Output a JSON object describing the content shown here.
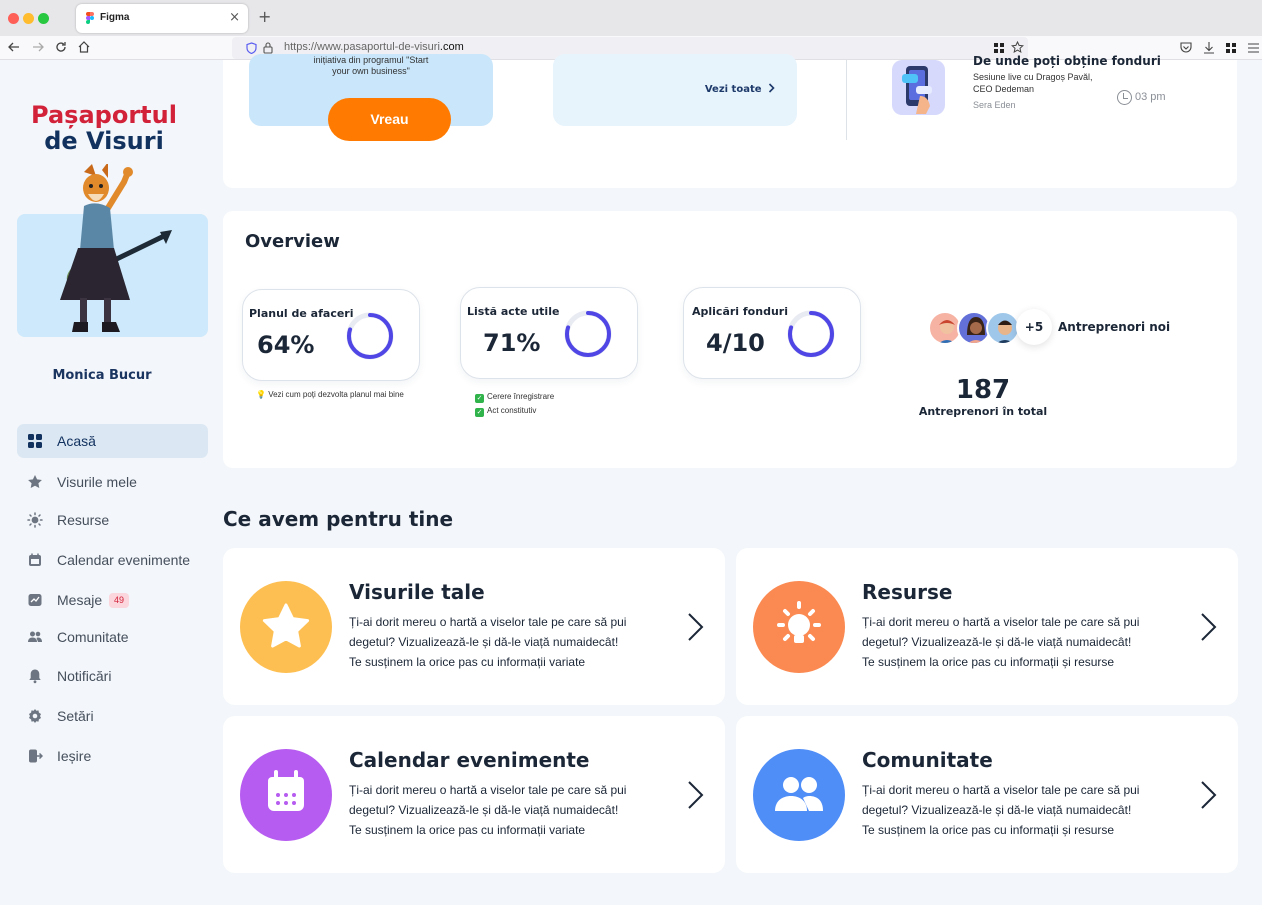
{
  "browser": {
    "tab_title": "Figma",
    "url_prefix": "https://www.pasaportul-de-visuri",
    "url_domain": ".com",
    "tab_close": "×",
    "new_tab": "+"
  },
  "brand": {
    "line1": "Pașaportul",
    "line2": "de Visuri"
  },
  "user": {
    "name": "Monica Bucur"
  },
  "sidebar": {
    "items": [
      {
        "label": "Acasă",
        "icon": "grid-icon"
      },
      {
        "label": "Visurile mele",
        "icon": "star-icon"
      },
      {
        "label": "Resurse",
        "icon": "bulb-icon"
      },
      {
        "label": "Calendar evenimente",
        "icon": "calendar-icon"
      },
      {
        "label": "Mesaje",
        "icon": "chart-message-icon",
        "badge": "49"
      },
      {
        "label": "Comunitate",
        "icon": "people-icon"
      },
      {
        "label": "Notificări",
        "icon": "bell-icon"
      },
      {
        "label": "Setări",
        "icon": "gear-icon"
      },
      {
        "label": "Ieșire",
        "icon": "logout-icon"
      }
    ]
  },
  "top": {
    "promo_text_line1": "inițiativa din programul \"Start",
    "promo_text_line2": "your own business\"",
    "cta": "Vreau",
    "see_all": "Vezi toate",
    "event": {
      "title": "De unde poți obține fonduri",
      "sub1": "Sesiune live cu Dragoș Pavăl,",
      "sub2": "CEO Dedeman",
      "host": "Sera Eden",
      "time": "03 pm"
    }
  },
  "overview": {
    "title": "Overview",
    "stats": [
      {
        "label": "Planul de afaceri",
        "value": "64%",
        "progress": 0.64
      },
      {
        "label": "Listă acte utile",
        "value": "71%",
        "progress": 0.71
      },
      {
        "label": "Aplicări fonduri",
        "value": "4/10",
        "progress": 0.4
      }
    ],
    "hint": "Vezi cum poți dezvolta planul mai bine",
    "checks": [
      "Cerere înregistrare",
      "Act constitutiv"
    ],
    "extra_count": "+5",
    "new_label": "Antreprenori noi",
    "total": "187",
    "total_label": "Antreprenori în total"
  },
  "section": {
    "title": "Ce avem pentru tine"
  },
  "features": [
    {
      "title": "Visurile tale",
      "line1": "Ți-ai dorit mereu o hartă a viselor tale pe care să pui",
      "line2": "degetul? Vizualizează-le și dă-le viață numaidecât!",
      "line3": "Te susținem la orice pas cu informații variate",
      "color": "#fdbf52"
    },
    {
      "title": "Resurse",
      "line1": "Ți-ai dorit mereu o hartă a viselor tale pe care să pui",
      "line2": "degetul? Vizualizează-le și dă-le viață numaidecât!",
      "line3": "Te susținem la orice pas cu informații și resurse",
      "color": "#fb8a52"
    },
    {
      "title": "Calendar evenimente",
      "line1": "Ți-ai dorit mereu o hartă a viselor tale pe care să pui",
      "line2": "degetul? Vizualizează-le și dă-le viață numaidecât!",
      "line3": "Te susținem la orice pas cu informații variate",
      "color": "#b65cf0"
    },
    {
      "title": "Comunitate",
      "line1": "Ți-ai dorit mereu o hartă a viselor tale pe care să pui",
      "line2": "degetul? Vizualizează-le și dă-le viață numaidecât!",
      "line3": "Te susținem la orice pas cu informații și resurse",
      "color": "#4f8df7"
    }
  ],
  "colors": {
    "brand_red": "#d2223a",
    "brand_navy": "#11315e",
    "ring": "#4f46e5",
    "cta": "#ff7a00"
  }
}
